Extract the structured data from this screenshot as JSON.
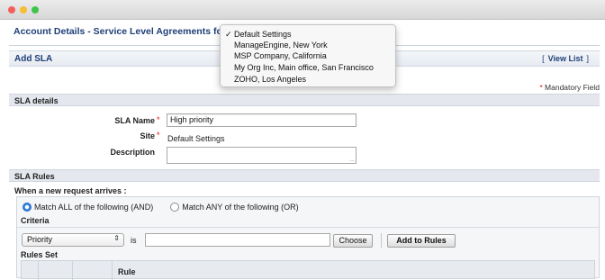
{
  "page_title": "Account Details - Service Level Agreements for",
  "add_sla": {
    "title": "Add SLA",
    "view_list_open": "[",
    "view_list_label": "View List",
    "view_list_close": "]"
  },
  "mandatory": {
    "star": "*",
    "label": "Mandatory Field"
  },
  "sla_details": {
    "section_title": "SLA details",
    "name_label": "SLA Name",
    "name_value": "High priority",
    "site_label": "Site",
    "site_value": "Default Settings",
    "description_label": "Description",
    "description_value": "",
    "required_star": "*",
    "resize_grip": "..."
  },
  "sla_rules": {
    "section_title": "SLA Rules",
    "when_label": "When a new request arrives :",
    "match_all_label": "Match ALL of the following (AND)",
    "match_any_label": "Match ANY of the following (OR)",
    "selected_match": "all",
    "criteria_label": "Criteria",
    "criteria_field": "Priority",
    "criteria_field_arrows": "⇕",
    "operator": "is",
    "criteria_value": "",
    "choose_button": "Choose",
    "add_button": "Add to Rules",
    "rules_set_label": "Rules Set",
    "rules_table_header": "Rule"
  },
  "site_dropdown": {
    "check": "✓",
    "options": [
      "Default Settings",
      "ManageEngine, New York",
      "MSP Company, California",
      "My Org Inc, Main office, San Francisco",
      "ZOHO, Los Angeles"
    ],
    "selected": "Default Settings"
  },
  "colors": {
    "title_blue": "#1f3f78",
    "required_red": "#dd1111",
    "radio_blue": "#2f7fe0"
  },
  "icons": [
    "close-dot",
    "minimize-dot",
    "zoom-dot",
    "checkmark-icon",
    "select-arrows-icon"
  ]
}
